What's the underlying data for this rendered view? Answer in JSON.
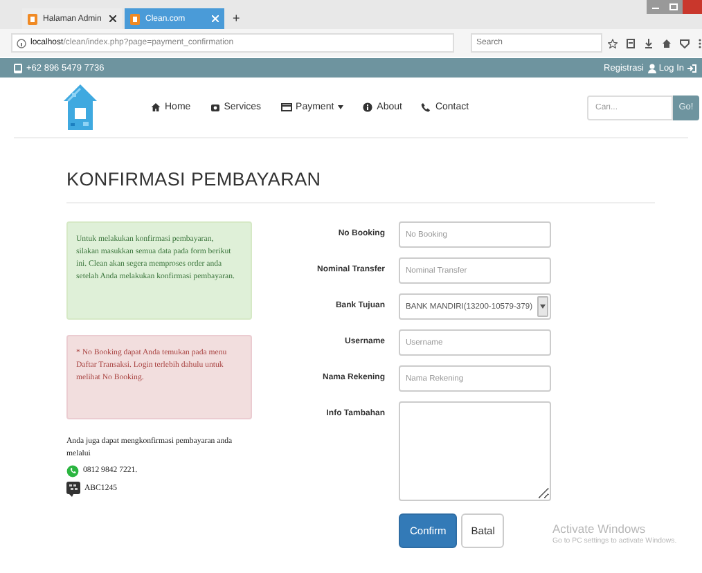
{
  "browser": {
    "tabs": [
      {
        "label": "Halaman Admin",
        "selected": false
      },
      {
        "label": "Clean.com",
        "selected": true
      }
    ],
    "new_tab": "+",
    "address_host": "localhost",
    "address_path": "/clean/index.php?page=payment_confirmation",
    "search_placeholder": "Search"
  },
  "topbar": {
    "phone": "+62 896 5479 7736",
    "register": "Registrasi",
    "login": "Log In"
  },
  "nav": {
    "items": [
      {
        "label": "Home",
        "dropdown": false
      },
      {
        "label": "Services",
        "dropdown": false
      },
      {
        "label": "Payment",
        "dropdown": true
      },
      {
        "label": "About",
        "dropdown": false
      },
      {
        "label": "Contact",
        "dropdown": false
      }
    ],
    "search_placeholder": "Cari...",
    "search_button": "Go!"
  },
  "title": "KONFIRMASI PEMBAYARAN",
  "alerts": [
    {
      "kind": "success",
      "text": "Untuk melakukan konfirmasi pembayaran,\nsilakan masukkan semua data pada form berikut ini. Clean akan segera memproses order anda setelah Anda melakukan konfirmasi pembayaran."
    },
    {
      "kind": "danger",
      "text": "* No Booking dapat Anda temukan pada menu Daftar Transaksi. Login terlebih dahulu untuk melihat No Booking."
    }
  ],
  "contact": {
    "intro": "Anda juga dapat mengkonfirmasi pembayaran anda melalui",
    "channels": [
      {
        "kind": "whatsapp",
        "text": "0812 9842 7221."
      },
      {
        "kind": "bbm",
        "text": "ABC1245"
      }
    ]
  },
  "form": {
    "fields": [
      {
        "label": "No Booking",
        "kind": "text",
        "placeholder": "No Booking"
      },
      {
        "label": "Nominal Transfer",
        "kind": "text",
        "placeholder": "Nominal Transfer"
      },
      {
        "label": "Bank Tujuan",
        "kind": "select",
        "value": "BANK MANDIRI(13200-10579-379)"
      },
      {
        "label": "Username",
        "kind": "text",
        "placeholder": "Username"
      },
      {
        "label": "Nama Rekening",
        "kind": "text",
        "placeholder": "Nama Rekening"
      },
      {
        "label": "Info Tambahan",
        "kind": "textarea"
      }
    ],
    "buttons": [
      {
        "label": "Confirm",
        "kind": "primary"
      },
      {
        "label": "Batal",
        "kind": "default"
      }
    ]
  },
  "os_notice": {
    "title": "Activate Windows",
    "text": "Go to PC settings to activate Windows."
  }
}
